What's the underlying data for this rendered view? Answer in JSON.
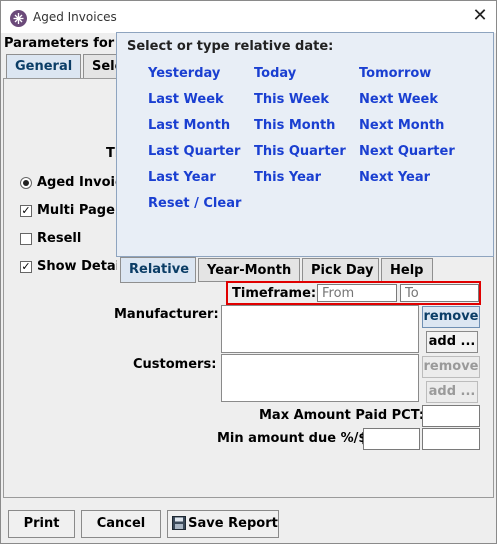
{
  "window": {
    "title": "Aged Invoices",
    "parameters_label": "Parameters for A"
  },
  "main_tabs": [
    {
      "label": "General",
      "active": true
    },
    {
      "label": "Sele",
      "active": false
    }
  ],
  "general": {
    "timeframe_fragment": "Ti",
    "aged_invoices_label": "Aged Invoic",
    "multi_page_label": "Multi Page",
    "resell_label": "Resell",
    "show_details_label": "Show Detai"
  },
  "date_popup": {
    "title": "Select or type relative date:",
    "links": [
      [
        "Yesterday",
        "Today",
        "Tomorrow"
      ],
      [
        "Last Week",
        "This Week",
        "Next Week"
      ],
      [
        "Last Month",
        "This Month",
        "Next Month"
      ],
      [
        "Last Quarter",
        "This Quarter",
        "Next Quarter"
      ],
      [
        "Last Year",
        "This Year",
        "Next Year"
      ]
    ],
    "reset_label": "Reset / Clear",
    "tabs": [
      {
        "label": "Relative",
        "active": true
      },
      {
        "label": "Year-Month",
        "active": false
      },
      {
        "label": "Pick Day",
        "active": false
      },
      {
        "label": "Help",
        "active": false
      }
    ]
  },
  "timeframe": {
    "label": "Timeframe:",
    "from_placeholder": "From",
    "to_placeholder": "To"
  },
  "manufacturer": {
    "label": "Manufacturer:",
    "remove_label": "remove",
    "add_label": "add ..."
  },
  "customers": {
    "label": "Customers:",
    "remove_label": "remove",
    "add_label": "add ..."
  },
  "max_amount_label": "Max Amount Paid PCT:",
  "min_amount_label": "Min amount due %/$",
  "buttons": {
    "print": "Print",
    "cancel": "Cancel",
    "save_report": "Save Report"
  }
}
